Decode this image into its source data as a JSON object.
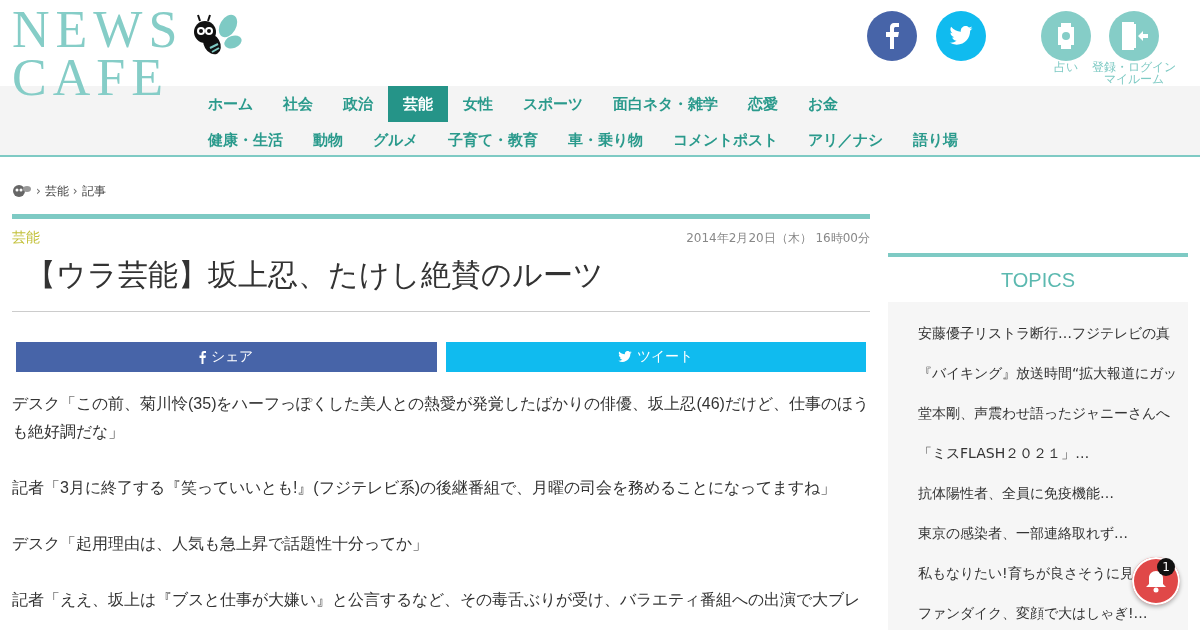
{
  "logo": {
    "line1": "NEWS",
    "line2": "CAFE"
  },
  "header_links": [
    {
      "kind": "facebook"
    },
    {
      "kind": "twitter"
    },
    {
      "kind": "fortune",
      "label": "占い"
    },
    {
      "kind": "login",
      "label_lines": [
        "登録・ログイン",
        "マイルーム"
      ]
    }
  ],
  "nav_rows": [
    [
      {
        "label": "ホーム",
        "selected": false
      },
      {
        "label": "社会",
        "selected": false
      },
      {
        "label": "政治",
        "selected": false
      },
      {
        "label": "芸能",
        "selected": true
      },
      {
        "label": "女性",
        "selected": false
      },
      {
        "label": "スポーツ",
        "selected": false
      },
      {
        "label": "面白ネタ・雑学",
        "selected": false
      },
      {
        "label": "恋愛",
        "selected": false
      },
      {
        "label": "お金",
        "selected": false
      }
    ],
    [
      {
        "label": "健康・生活",
        "selected": false
      },
      {
        "label": "動物",
        "selected": false
      },
      {
        "label": "グルメ",
        "selected": false
      },
      {
        "label": "子育て・教育",
        "selected": false
      },
      {
        "label": "車・乗り物",
        "selected": false
      },
      {
        "label": "コメントポスト",
        "selected": false
      },
      {
        "label": "アリ／ナシ",
        "selected": false
      },
      {
        "label": "語り場",
        "selected": false
      }
    ]
  ],
  "breadcrumb": [
    {
      "separator": "›",
      "label": "芸能"
    },
    {
      "separator": "›",
      "label": "記事"
    }
  ],
  "article": {
    "category": "芸能",
    "date": "2014年2月20日（木） 16時00分",
    "title": "【ウラ芸能】坂上忍、たけし絶賛のルーツ",
    "share_buttons": [
      {
        "kind": "facebook",
        "label": "シェア"
      },
      {
        "kind": "twitter",
        "label": "ツイート"
      }
    ],
    "paragraphs": [
      "デスク「この前、菊川怜(35)をハーフっぽくした美人との熱愛が発覚したばかりの俳優、坂上忍(46)だけど、仕事のほうも絶好調だな」",
      "記者「3月に終了する『笑っていいとも!』(フジテレビ系)の後継番組で、月曜の司会を務めることになってますね」",
      "デスク「起用理由は、人気も急上昇で話題性十分ってか」",
      "記者「ええ、坂上は『ブスと仕事が大嫌い』と公言するなど、その毒舌ぶりが受け、バラエティ番組への出演で大ブレ"
    ]
  },
  "topics": {
    "title": "TOPICS",
    "items": [
      "安藤優子リストラ断行…フジテレビの真",
      "『バイキング』放送時間“拡大報道にガッ",
      "堂本剛、声震わせ語ったジャニーさんへ",
      "「ミスFLASH２０２１」…",
      "抗体陽性者、全員に免疫機能…",
      "東京の感染者、一部連絡取れず…",
      "私もなりたい!育ちが良さそうに見",
      "ファンダイク、変顔で大はしゃぎ!…"
    ]
  },
  "notification": {
    "count": "1"
  }
}
